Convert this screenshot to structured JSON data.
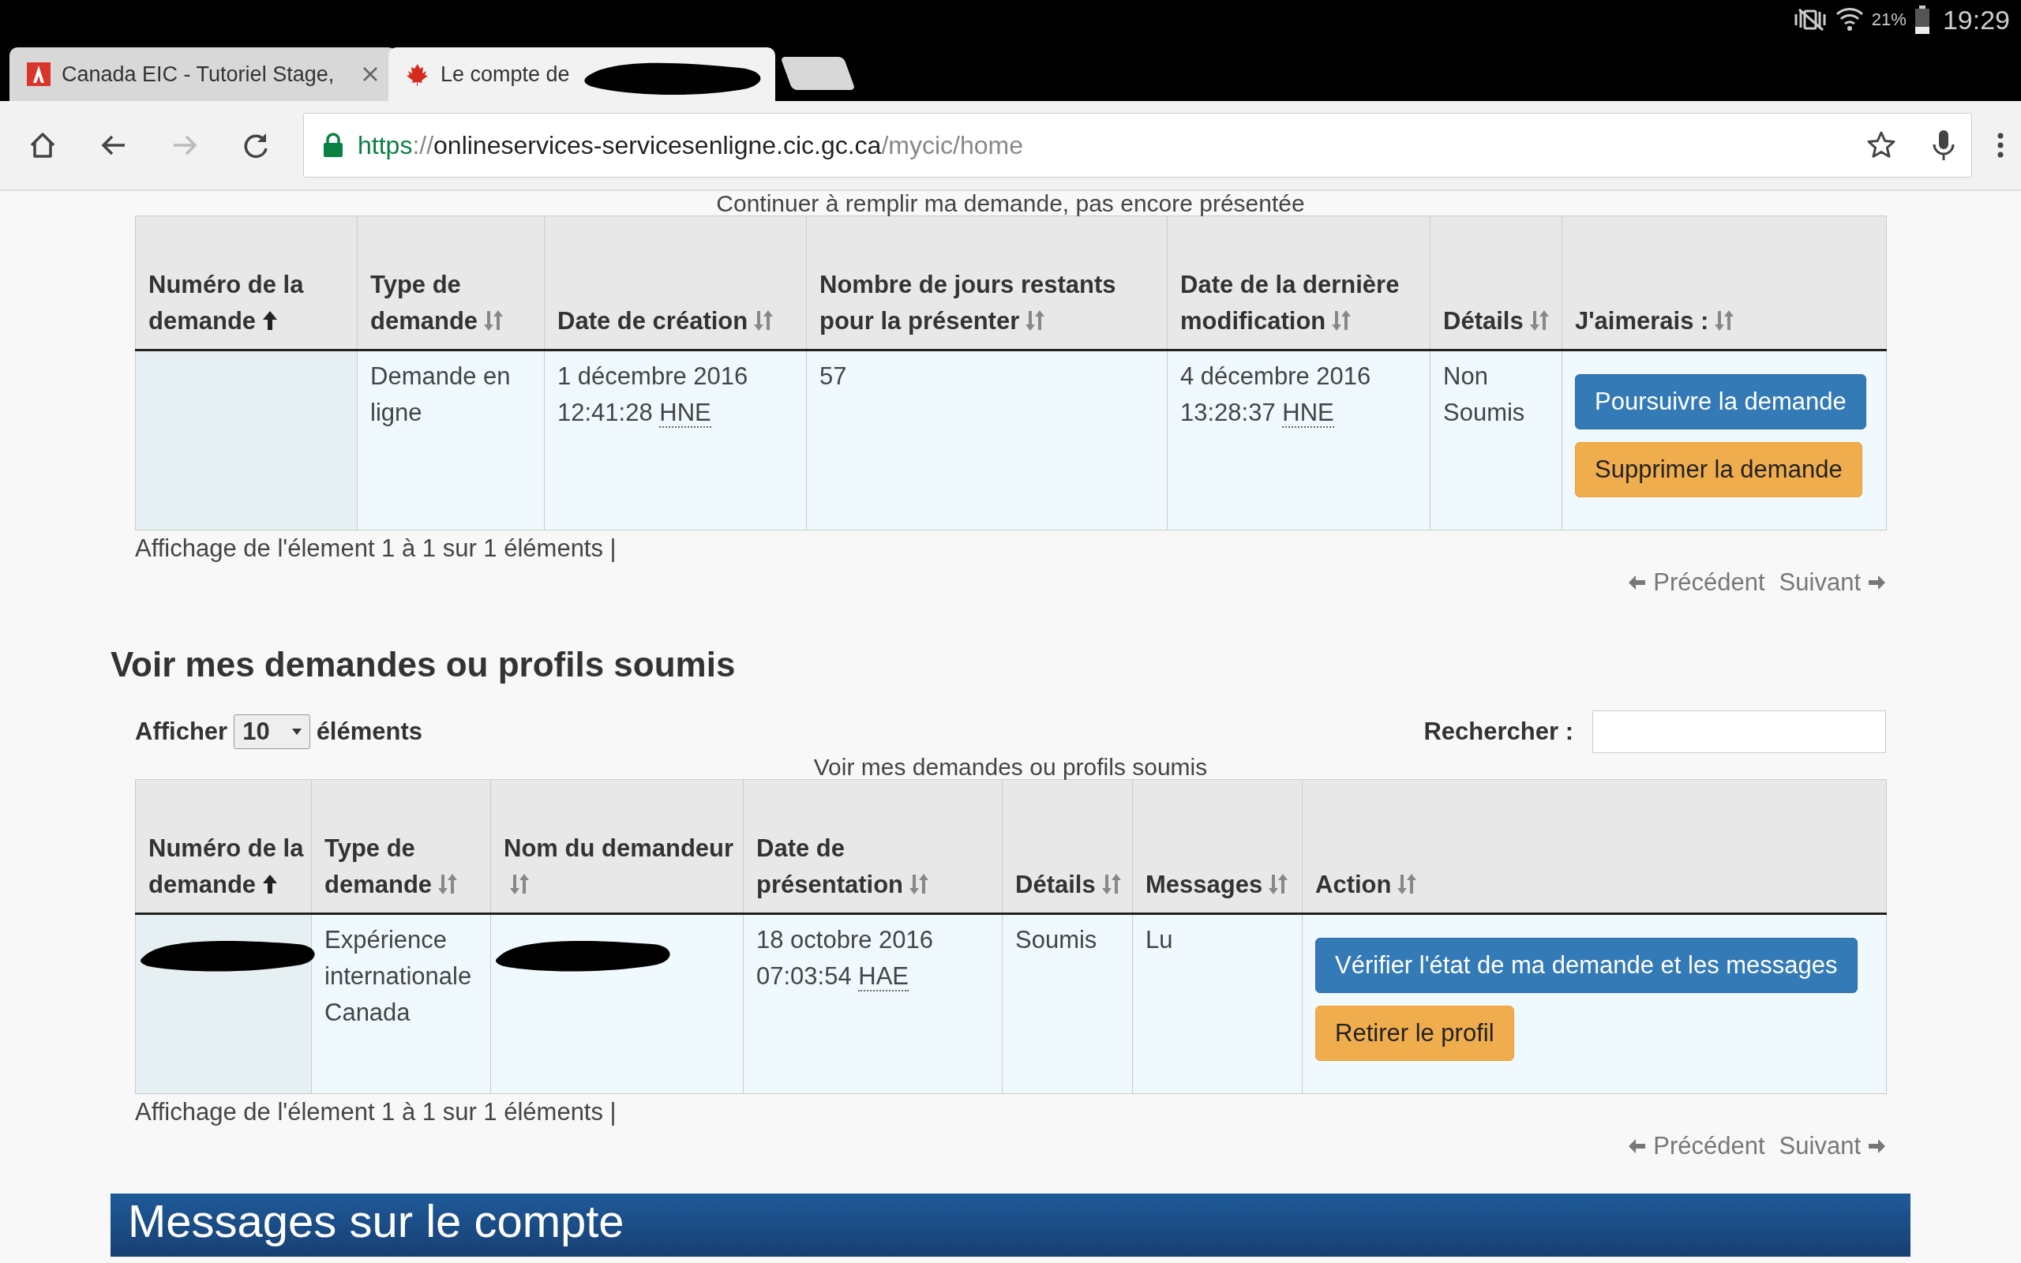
{
  "status_bar": {
    "battery": "21%",
    "time": "19:29"
  },
  "tabs": [
    {
      "title": "Canada EIC - Tutoriel Stage,",
      "selected": false,
      "kind": "tower",
      "closable": true,
      "redacted": false
    },
    {
      "title": "Le compte de",
      "selected": true,
      "kind": "leaf",
      "closable": false,
      "redacted": true
    }
  ],
  "toolbar": {
    "forward_disabled": true,
    "url": [
      {
        "text": "https",
        "kind": "secure"
      },
      {
        "text": "://",
        "kind": "dim"
      },
      {
        "text": "onlineservices-servicesenligne.cic.gc.ca",
        "kind": "host"
      },
      {
        "text": "/mycic/home",
        "kind": "dim"
      }
    ]
  },
  "pending": {
    "caption": "Continuer à remplir ma demande, pas encore présentée",
    "columns": [
      {
        "label": "Numéro de la demande",
        "sorted": true
      },
      {
        "label": "Type de demande",
        "sorted": false
      },
      {
        "label": "Date de création",
        "sorted": false
      },
      {
        "label": "Nombre de jours restants pour la présenter",
        "sorted": false
      },
      {
        "label": "Date de la dernière modification",
        "sorted": false
      },
      {
        "label": "Détails",
        "sorted": false
      },
      {
        "label": "J'aimerais :",
        "sorted": false
      }
    ],
    "rows": [
      {
        "cells": [
          {
            "kind": "empty"
          },
          {
            "kind": "text",
            "text": "Demande en ligne"
          },
          {
            "kind": "datetime",
            "text": "1 décembre 2016 12:41:28",
            "abbr": "HNE"
          },
          {
            "kind": "text",
            "text": "57"
          },
          {
            "kind": "datetime",
            "text": "4 décembre 2016 13:28:37",
            "abbr": "HNE"
          },
          {
            "kind": "text",
            "text": "Non Soumis"
          },
          {
            "kind": "actions",
            "buttons": [
              {
                "label": "Poursuivre la demande",
                "kind": "primary"
              },
              {
                "label": "Supprimer la demande",
                "kind": "warning"
              }
            ]
          }
        ]
      }
    ],
    "info": "Affichage de l'élement 1 à 1 sur 1 éléments |",
    "pager": [
      {
        "label": "Précédent",
        "kind": "prev",
        "disabled": true
      },
      {
        "label": "Suivant",
        "kind": "next",
        "disabled": true
      }
    ]
  },
  "submitted": {
    "heading": "Voir mes demandes ou profils soumis",
    "length_label": "Afficher",
    "length_value": "10",
    "length_suffix": "éléments",
    "search_label": "Rechercher :",
    "caption": "Voir mes demandes ou profils soumis",
    "columns": [
      {
        "label": "Numéro de la demande",
        "sorted": true
      },
      {
        "label": "Type de demande",
        "sorted": false
      },
      {
        "label": "Nom du demandeur",
        "sorted": false
      },
      {
        "label": "Date de présentation",
        "sorted": false
      },
      {
        "label": "Détails",
        "sorted": false
      },
      {
        "label": "Messages",
        "sorted": false
      },
      {
        "label": "Action",
        "sorted": false
      }
    ],
    "rows": [
      {
        "cells": [
          {
            "kind": "redacted"
          },
          {
            "kind": "text",
            "text": "Expérience internationale Canada"
          },
          {
            "kind": "redacted"
          },
          {
            "kind": "datetime",
            "text": "18 octobre 2016 07:03:54",
            "abbr": "HAE"
          },
          {
            "kind": "text",
            "text": "Soumis"
          },
          {
            "kind": "text",
            "text": "Lu"
          },
          {
            "kind": "actions",
            "buttons": [
              {
                "label": "Vérifier l'état de ma demande et les messages",
                "kind": "primary"
              },
              {
                "label": "Retirer le profil",
                "kind": "warning"
              }
            ]
          }
        ]
      }
    ],
    "info": "Affichage de l'élement 1 à 1 sur 1 éléments |",
    "pager": [
      {
        "label": "Précédent",
        "kind": "prev",
        "disabled": true
      },
      {
        "label": "Suivant",
        "kind": "next",
        "disabled": true
      }
    ]
  },
  "messages_banner": {
    "title": "Messages sur le compte"
  }
}
